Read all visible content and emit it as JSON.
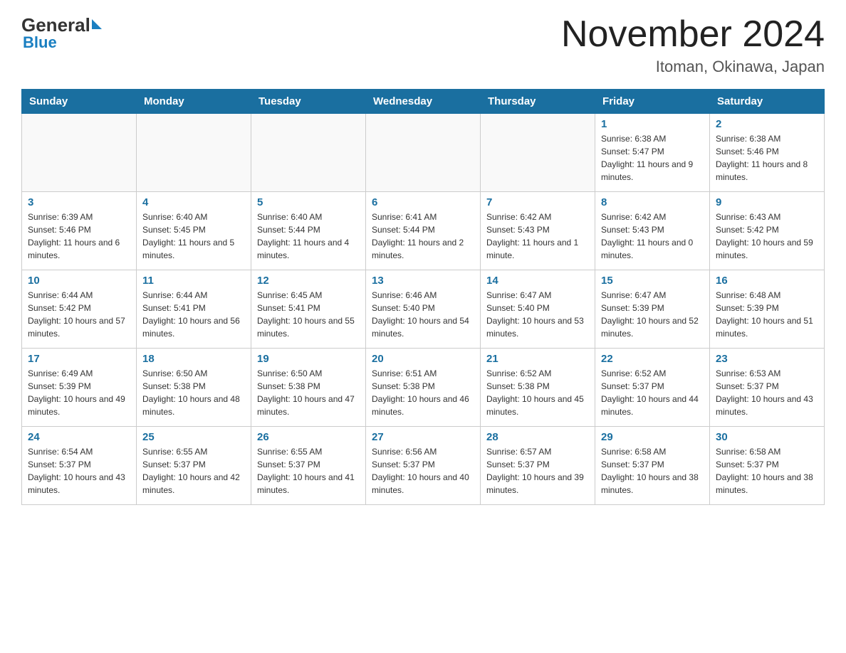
{
  "logo": {
    "general": "General",
    "blue": "Blue"
  },
  "header": {
    "month_year": "November 2024",
    "location": "Itoman, Okinawa, Japan"
  },
  "weekdays": [
    "Sunday",
    "Monday",
    "Tuesday",
    "Wednesday",
    "Thursday",
    "Friday",
    "Saturday"
  ],
  "weeks": [
    [
      {
        "day": "",
        "info": ""
      },
      {
        "day": "",
        "info": ""
      },
      {
        "day": "",
        "info": ""
      },
      {
        "day": "",
        "info": ""
      },
      {
        "day": "",
        "info": ""
      },
      {
        "day": "1",
        "info": "Sunrise: 6:38 AM\nSunset: 5:47 PM\nDaylight: 11 hours and 9 minutes."
      },
      {
        "day": "2",
        "info": "Sunrise: 6:38 AM\nSunset: 5:46 PM\nDaylight: 11 hours and 8 minutes."
      }
    ],
    [
      {
        "day": "3",
        "info": "Sunrise: 6:39 AM\nSunset: 5:46 PM\nDaylight: 11 hours and 6 minutes."
      },
      {
        "day": "4",
        "info": "Sunrise: 6:40 AM\nSunset: 5:45 PM\nDaylight: 11 hours and 5 minutes."
      },
      {
        "day": "5",
        "info": "Sunrise: 6:40 AM\nSunset: 5:44 PM\nDaylight: 11 hours and 4 minutes."
      },
      {
        "day": "6",
        "info": "Sunrise: 6:41 AM\nSunset: 5:44 PM\nDaylight: 11 hours and 2 minutes."
      },
      {
        "day": "7",
        "info": "Sunrise: 6:42 AM\nSunset: 5:43 PM\nDaylight: 11 hours and 1 minute."
      },
      {
        "day": "8",
        "info": "Sunrise: 6:42 AM\nSunset: 5:43 PM\nDaylight: 11 hours and 0 minutes."
      },
      {
        "day": "9",
        "info": "Sunrise: 6:43 AM\nSunset: 5:42 PM\nDaylight: 10 hours and 59 minutes."
      }
    ],
    [
      {
        "day": "10",
        "info": "Sunrise: 6:44 AM\nSunset: 5:42 PM\nDaylight: 10 hours and 57 minutes."
      },
      {
        "day": "11",
        "info": "Sunrise: 6:44 AM\nSunset: 5:41 PM\nDaylight: 10 hours and 56 minutes."
      },
      {
        "day": "12",
        "info": "Sunrise: 6:45 AM\nSunset: 5:41 PM\nDaylight: 10 hours and 55 minutes."
      },
      {
        "day": "13",
        "info": "Sunrise: 6:46 AM\nSunset: 5:40 PM\nDaylight: 10 hours and 54 minutes."
      },
      {
        "day": "14",
        "info": "Sunrise: 6:47 AM\nSunset: 5:40 PM\nDaylight: 10 hours and 53 minutes."
      },
      {
        "day": "15",
        "info": "Sunrise: 6:47 AM\nSunset: 5:39 PM\nDaylight: 10 hours and 52 minutes."
      },
      {
        "day": "16",
        "info": "Sunrise: 6:48 AM\nSunset: 5:39 PM\nDaylight: 10 hours and 51 minutes."
      }
    ],
    [
      {
        "day": "17",
        "info": "Sunrise: 6:49 AM\nSunset: 5:39 PM\nDaylight: 10 hours and 49 minutes."
      },
      {
        "day": "18",
        "info": "Sunrise: 6:50 AM\nSunset: 5:38 PM\nDaylight: 10 hours and 48 minutes."
      },
      {
        "day": "19",
        "info": "Sunrise: 6:50 AM\nSunset: 5:38 PM\nDaylight: 10 hours and 47 minutes."
      },
      {
        "day": "20",
        "info": "Sunrise: 6:51 AM\nSunset: 5:38 PM\nDaylight: 10 hours and 46 minutes."
      },
      {
        "day": "21",
        "info": "Sunrise: 6:52 AM\nSunset: 5:38 PM\nDaylight: 10 hours and 45 minutes."
      },
      {
        "day": "22",
        "info": "Sunrise: 6:52 AM\nSunset: 5:37 PM\nDaylight: 10 hours and 44 minutes."
      },
      {
        "day": "23",
        "info": "Sunrise: 6:53 AM\nSunset: 5:37 PM\nDaylight: 10 hours and 43 minutes."
      }
    ],
    [
      {
        "day": "24",
        "info": "Sunrise: 6:54 AM\nSunset: 5:37 PM\nDaylight: 10 hours and 43 minutes."
      },
      {
        "day": "25",
        "info": "Sunrise: 6:55 AM\nSunset: 5:37 PM\nDaylight: 10 hours and 42 minutes."
      },
      {
        "day": "26",
        "info": "Sunrise: 6:55 AM\nSunset: 5:37 PM\nDaylight: 10 hours and 41 minutes."
      },
      {
        "day": "27",
        "info": "Sunrise: 6:56 AM\nSunset: 5:37 PM\nDaylight: 10 hours and 40 minutes."
      },
      {
        "day": "28",
        "info": "Sunrise: 6:57 AM\nSunset: 5:37 PM\nDaylight: 10 hours and 39 minutes."
      },
      {
        "day": "29",
        "info": "Sunrise: 6:58 AM\nSunset: 5:37 PM\nDaylight: 10 hours and 38 minutes."
      },
      {
        "day": "30",
        "info": "Sunrise: 6:58 AM\nSunset: 5:37 PM\nDaylight: 10 hours and 38 minutes."
      }
    ]
  ]
}
